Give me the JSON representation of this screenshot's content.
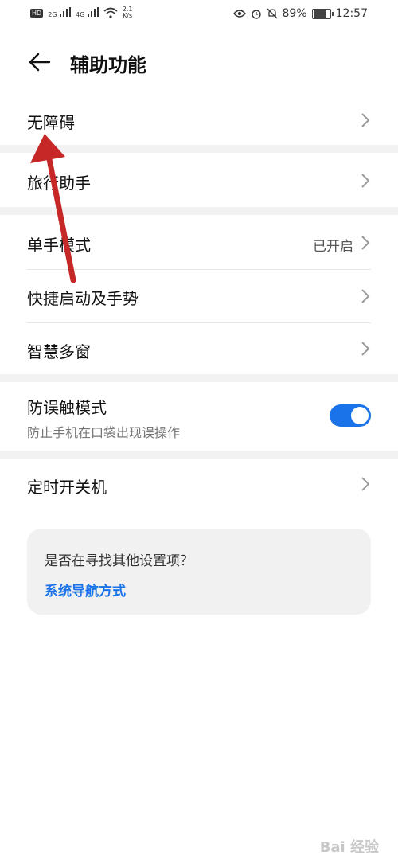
{
  "status_bar": {
    "hd": "HD",
    "sig1": "2G",
    "sig2": "4G",
    "speed_top": "2.1",
    "speed_bottom": "K/s",
    "battery": "89%",
    "time": "12:57"
  },
  "header": {
    "title": "辅助功能"
  },
  "items": [
    {
      "label": "无障碍"
    },
    {
      "label": "旅行助手"
    },
    {
      "label": "单手模式",
      "value": "已开启"
    },
    {
      "label": "快捷启动及手势"
    },
    {
      "label": "智慧多窗"
    },
    {
      "label": "防误触模式",
      "subtitle": "防止手机在口袋出现误操作",
      "toggle_on": true
    },
    {
      "label": "定时开关机"
    }
  ],
  "suggestion": {
    "question": "是否在寻找其他设置项？",
    "link": "系统导航方式"
  },
  "watermark": "Bai 经验",
  "colors": {
    "accent": "#1a73e8",
    "arrow": "#c62828"
  }
}
